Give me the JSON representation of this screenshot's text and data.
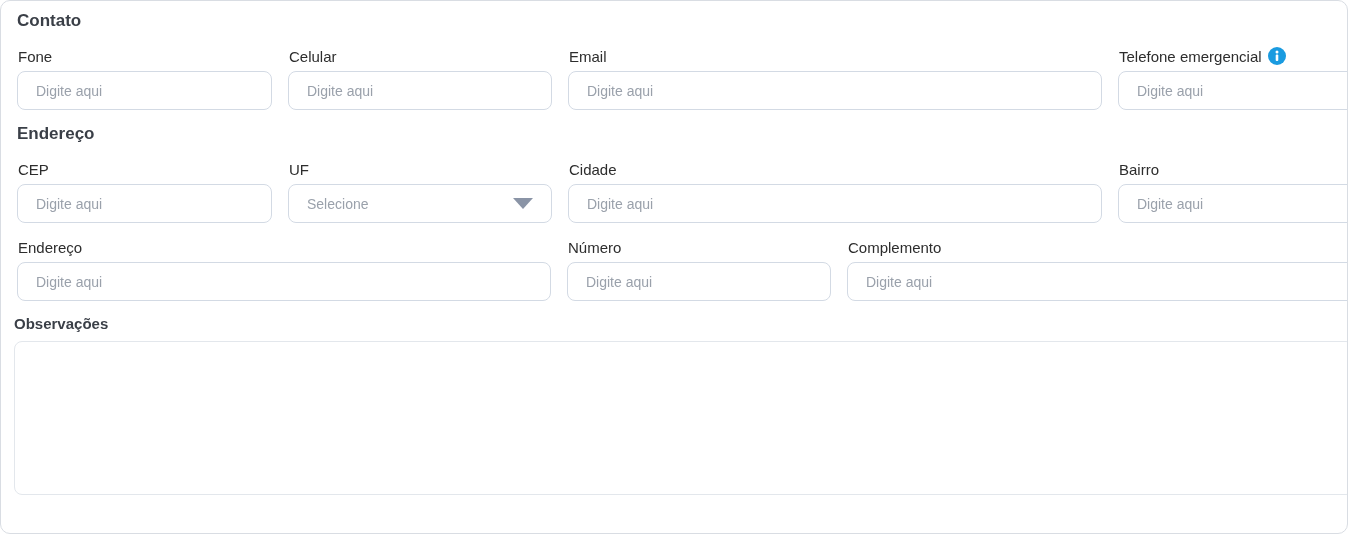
{
  "sections": [
    {
      "title": "Contato",
      "lines": [
        {
          "fields": [
            {
              "label": "Fone",
              "kind": "input",
              "placeholder": "Digite aqui"
            },
            {
              "label": "Celular",
              "kind": "input",
              "placeholder": "Digite aqui"
            },
            {
              "label": "Email",
              "kind": "input",
              "placeholder": "Digite aqui"
            },
            {
              "label": "Telefone emergencial",
              "kind": "input",
              "placeholder": "Digite aqui",
              "info": true
            }
          ]
        }
      ]
    },
    {
      "title": "Endereço",
      "lines": [
        {
          "fields": [
            {
              "label": "CEP",
              "kind": "input",
              "placeholder": "Digite aqui"
            },
            {
              "label": "UF",
              "kind": "select",
              "placeholder": "Selecione"
            },
            {
              "label": "Cidade",
              "kind": "input",
              "placeholder": "Digite aqui"
            },
            {
              "label": "Bairro",
              "kind": "input",
              "placeholder": "Digite aqui"
            }
          ]
        },
        {
          "fields": [
            {
              "label": "Endereço",
              "kind": "input",
              "placeholder": "Digite aqui"
            },
            {
              "label": "Número",
              "kind": "input",
              "placeholder": "Digite aqui"
            },
            {
              "label": "Complemento",
              "kind": "input",
              "placeholder": "Digite aqui"
            }
          ]
        }
      ]
    }
  ],
  "observacoes": {
    "label": "Observações"
  }
}
